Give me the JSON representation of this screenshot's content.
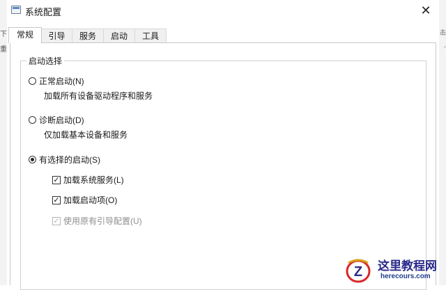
{
  "window": {
    "title": "系统配置",
    "close_glyph": "✕"
  },
  "background_fragments": {
    "left": [
      "下",
      "重"
    ],
    "right": [
      "击",
      "-"
    ]
  },
  "tabs": [
    {
      "label": "常规",
      "active": true
    },
    {
      "label": "引导",
      "active": false
    },
    {
      "label": "服务",
      "active": false
    },
    {
      "label": "启动",
      "active": false
    },
    {
      "label": "工具",
      "active": false
    }
  ],
  "startup_selection": {
    "legend": "启动选择",
    "normal": {
      "label": "正常启动(N)",
      "desc": "加载所有设备驱动程序和服务",
      "selected": false
    },
    "diagnostic": {
      "label": "诊断启动(D)",
      "desc": "仅加载基本设备和服务",
      "selected": false
    },
    "selective": {
      "label": "有选择的启动(S)",
      "selected": true,
      "options": [
        {
          "label": "加载系统服务(L)",
          "checked": true,
          "enabled": true
        },
        {
          "label": "加载启动项(O)",
          "checked": true,
          "enabled": true
        },
        {
          "label": "使用原有引导配置(U)",
          "checked": true,
          "enabled": false
        }
      ]
    }
  },
  "watermark": {
    "title": "这里教程网",
    "url": "herecours.com",
    "logo_letter": "Z",
    "colors": {
      "red": "#d62828",
      "blue": "#2a2a8a",
      "gold": "#d9a21b"
    }
  },
  "icons": {
    "app": "system-config-icon",
    "check": "✓"
  }
}
